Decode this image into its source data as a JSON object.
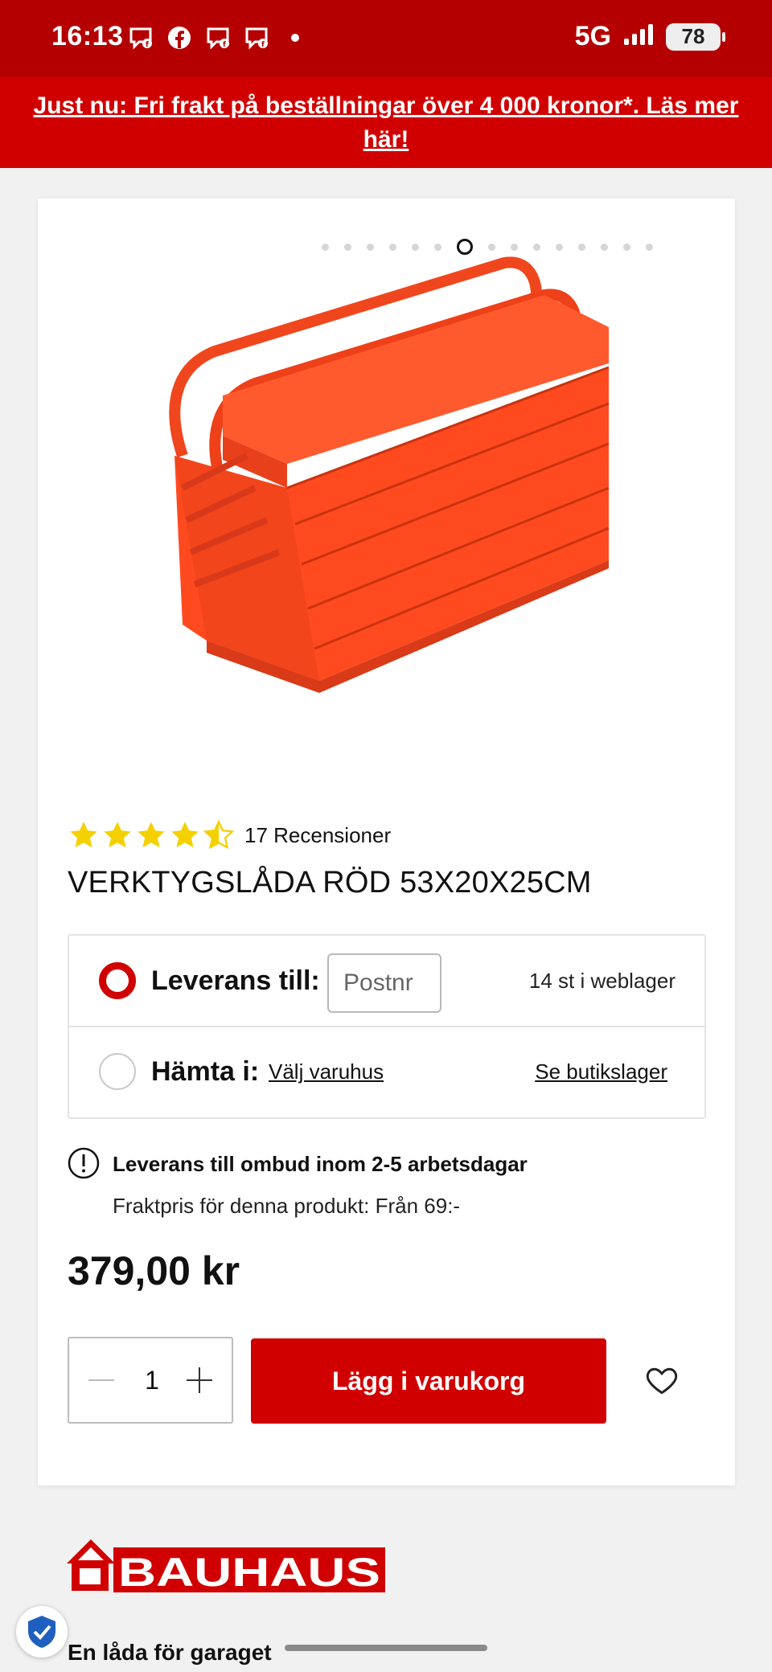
{
  "status_bar": {
    "time": "16:13",
    "network": "5G",
    "battery": "78"
  },
  "promo_banner": {
    "text": "Just nu: Fri frakt på beställningar över 4 000 kronor*. Läs mer här!"
  },
  "gallery": {
    "total_images": 15,
    "active_index": 6,
    "icon": "toolbox-image"
  },
  "product": {
    "rating": 4.5,
    "review_count_label": "17 Recensioner",
    "title": "VERKTYGSLÅDA RÖD 53X20X25CM"
  },
  "delivery": {
    "option1_label": "Leverans till:",
    "postnr_placeholder": "Postnr",
    "stock_text": "14 st i weblager",
    "option2_label": "Hämta i:",
    "choose_store": "Välj varuhus",
    "store_stock_link": "Se butikslager"
  },
  "shipping_info": {
    "title": "Leverans till ombud inom 2-5 arbetsdagar",
    "subtitle": "Fraktpris för denna produkt: Från 69:-"
  },
  "price": "379,00 kr",
  "cart": {
    "quantity": "1",
    "add_label": "Lägg i varukorg"
  },
  "footer": {
    "logo_text": "BAUHAUS",
    "heading": "En låda för garaget"
  },
  "colors": {
    "brand_red": "#d10000",
    "status_red": "#b40000",
    "star": "#f5d000"
  }
}
